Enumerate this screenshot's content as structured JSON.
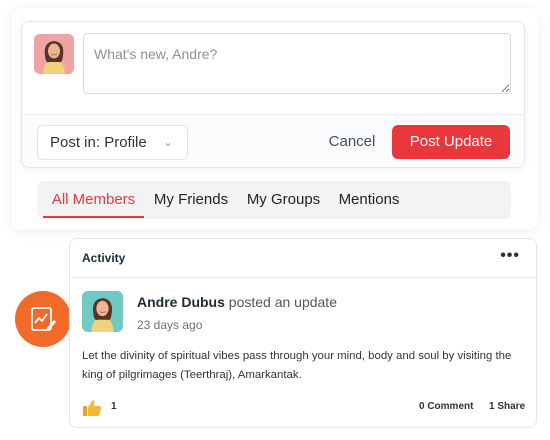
{
  "composer": {
    "placeholder": "What's new, Andre?",
    "post_in_label": "Post in: Profile",
    "cancel_label": "Cancel",
    "submit_label": "Post Update"
  },
  "tabs": [
    {
      "label": "All Members",
      "active": true
    },
    {
      "label": "My Friends",
      "active": false
    },
    {
      "label": "My Groups",
      "active": false
    },
    {
      "label": "Mentions",
      "active": false
    }
  ],
  "activity": {
    "title": "Activity",
    "author": "Andre Dubus",
    "action": "posted an update",
    "time": "23 days ago",
    "body": "Let the divinity of spiritual vibes pass through your mind, body and soul by visiting the king of pilgrimages (Teerthraj), Amarkantak.",
    "likes": "1",
    "comments": "0 Comment",
    "shares": "1 Share"
  },
  "colors": {
    "accent": "#e8383d",
    "fab": "#f26a2a"
  },
  "icons": {
    "fab": "edit-chart-icon",
    "like": "thumbs-up-icon",
    "more": "more-dots-icon",
    "select": "chevron-down-icon"
  }
}
